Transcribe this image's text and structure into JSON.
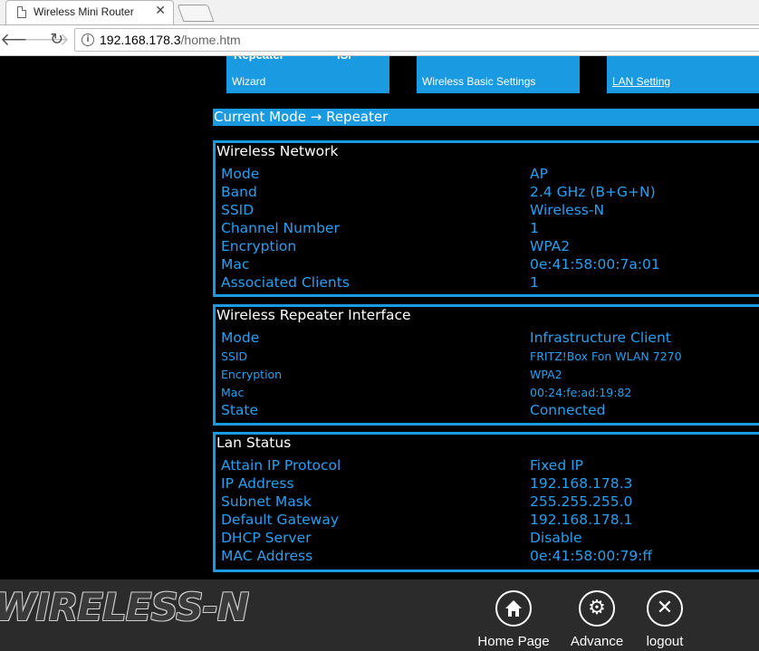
{
  "browser": {
    "tab_title": "Wireless Mini Router",
    "tab_close": "✕",
    "url_host": "192.168.178.3",
    "url_path": "/home.htm"
  },
  "menu": {
    "tile1_label": "Wizard",
    "tile1_cut": "Repeater",
    "tile1_cut2": "ISP",
    "tile2_label": "Wireless Basic Settings",
    "tile3_label": "LAN Setting"
  },
  "current_mode": "Current Mode → Repeater",
  "wireless_network": {
    "title": "Wireless Network",
    "rows": [
      {
        "k": "Mode",
        "v": "AP"
      },
      {
        "k": "Band",
        "v": "2.4 GHz (B+G+N)"
      },
      {
        "k": "SSID",
        "v": "Wireless-N"
      },
      {
        "k": "Channel Number",
        "v": "1"
      },
      {
        "k": "Encryption",
        "v": "WPA2"
      },
      {
        "k": "Mac",
        "v": "0e:41:58:00:7a:01"
      },
      {
        "k": "Associated Clients",
        "v": "1"
      }
    ]
  },
  "repeater_interface": {
    "title": "Wireless Repeater Interface",
    "rows": [
      {
        "k": "Mode",
        "v": "Infrastructure Client"
      },
      {
        "k": "SSID",
        "v": "FRITZ!Box Fon WLAN 7270"
      },
      {
        "k": "Encryption",
        "v": "WPA2"
      },
      {
        "k": "Mac",
        "v": "00:24:fe:ad:19:82"
      },
      {
        "k": "State",
        "v": "Connected"
      }
    ]
  },
  "lan_status": {
    "title": "Lan Status",
    "rows": [
      {
        "k": "Attain IP Protocol",
        "v": "Fixed IP"
      },
      {
        "k": "IP Address",
        "v": "192.168.178.3"
      },
      {
        "k": "Subnet Mask",
        "v": "255.255.255.0"
      },
      {
        "k": "Default Gateway",
        "v": "192.168.178.1"
      },
      {
        "k": "DHCP Server",
        "v": "Disable"
      },
      {
        "k": "MAC Address",
        "v": "0e:41:58:00:79:ff"
      }
    ]
  },
  "footer": {
    "brand": "WIRELESS-N",
    "home_label": "Home Page",
    "advance_label": "Advance",
    "logout_label": "logout"
  },
  "colors": {
    "accent": "#1a9ae0",
    "value_text": "#2a9ff0",
    "background": "#000000",
    "footer": "#2b2b2b"
  }
}
